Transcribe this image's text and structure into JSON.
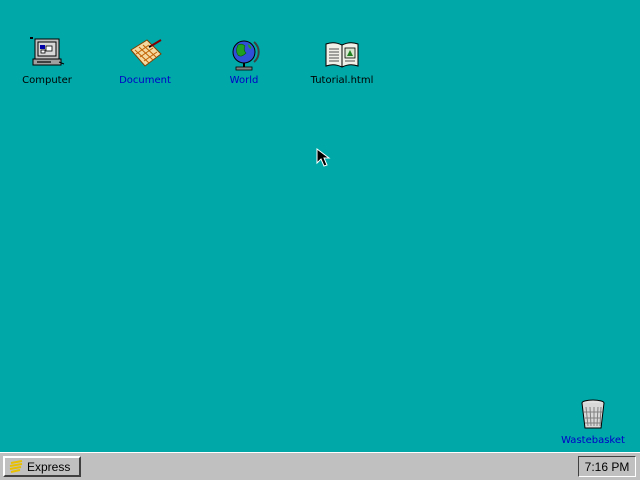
{
  "desktop": {
    "background_color": "#00A8A8",
    "icons": [
      {
        "label": "Computer",
        "icon": "computer-icon",
        "label_color": "#000000"
      },
      {
        "label": "Document",
        "icon": "document-icon",
        "label_color": "#0000C8"
      },
      {
        "label": "World",
        "icon": "globe-icon",
        "label_color": "#0000C8"
      },
      {
        "label": "Tutorial.html",
        "icon": "book-icon",
        "label_color": "#000000"
      },
      {
        "label": "Wastebasket",
        "icon": "wastebasket-icon",
        "label_color": "#0000C8"
      }
    ]
  },
  "taskbar": {
    "start_label": "Express",
    "start_icon": "express-logo-icon",
    "clock": "7:16 PM"
  },
  "cursor": {
    "icon": "mouse-pointer-icon"
  }
}
